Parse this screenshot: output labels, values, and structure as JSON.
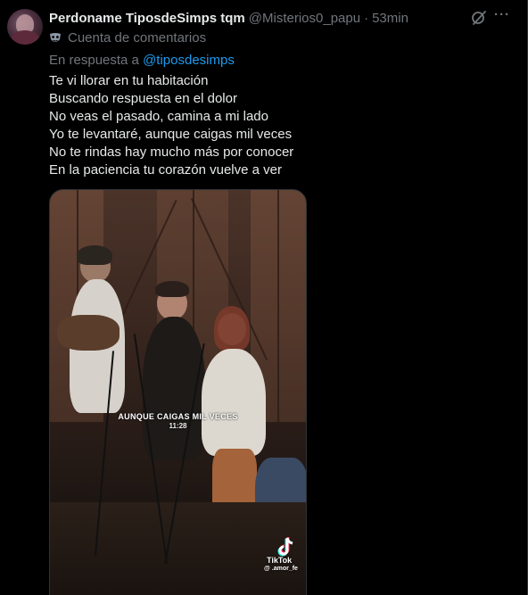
{
  "post": {
    "display_name": "Perdoname TiposdeSimps tqm",
    "handle": "@Misterios0_papu",
    "separator": "·",
    "time": "53min",
    "account_label": "Cuenta de comentarios",
    "reply_prefix": "En respuesta a ",
    "reply_handle": "@tiposdesimps",
    "lines": [
      "Te vi llorar en tu habitación",
      "Buscando respuesta en el dolor",
      "No veas el pasado, camina a mi lado",
      "Yo te levantaré, aunque caigas mil veces",
      "No te rindas hay mucho más por conocer",
      "En la paciencia tu corazón vuelve a ver"
    ],
    "more_label": "···"
  },
  "video": {
    "caption": "AUNQUE CAIGAS MIL VECES",
    "caption_time": "11:28",
    "brand": "TikTok",
    "brand_user": "@ .amor_fe"
  },
  "colors": {
    "background": "#000000",
    "text": "#e7e9ea",
    "muted": "#71767b",
    "link": "#1d9bf0"
  },
  "icons": {
    "grok": "grok-icon",
    "more": "more-icon",
    "account": "mask-icon",
    "tiktok": "tiktok-logo-icon"
  }
}
